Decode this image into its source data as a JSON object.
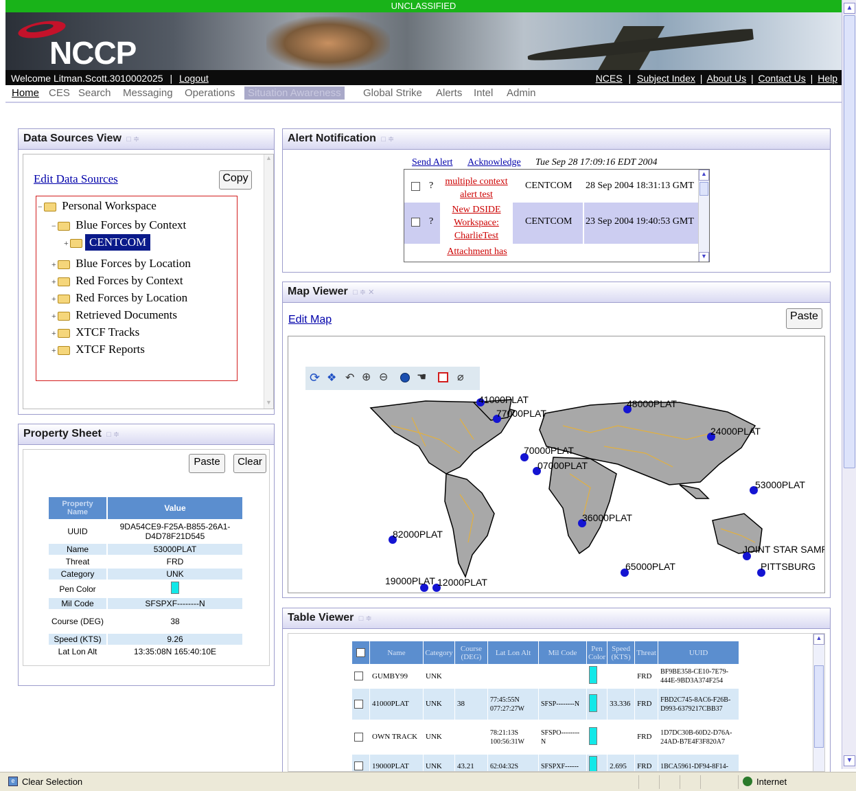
{
  "classification": "UNCLASSIFIED",
  "header": {
    "logo": "NCCP",
    "welcome": "Welcome Litman.Scott.3010002025",
    "logout": "Logout",
    "separator": "|",
    "links": [
      "NCES",
      "Subject Index",
      "About Us",
      "Contact Us",
      "Help"
    ]
  },
  "nav": {
    "tabs": [
      "Home",
      "CES",
      "Search",
      "Messaging",
      "Operations",
      "Situation Awareness",
      "Global Strike",
      "Alerts",
      "Intel",
      "Admin"
    ],
    "active": "Home",
    "selected": "Situation Awareness"
  },
  "data_sources": {
    "title": "Data Sources View",
    "edit_link": "Edit Data Sources",
    "copy_button": "Copy",
    "tree": [
      {
        "label": "Personal Workspace",
        "sign": "−"
      },
      {
        "label": "Blue Forces by Context",
        "sign": "−"
      },
      {
        "label": "CENTCOM",
        "sign": "+",
        "selected": true
      },
      {
        "label": "Blue Forces by Location",
        "sign": "+"
      },
      {
        "label": "Red Forces by Context",
        "sign": "+"
      },
      {
        "label": "Red Forces by Location",
        "sign": "+"
      },
      {
        "label": "Retrieved Documents",
        "sign": "+"
      },
      {
        "label": "XTCF Tracks",
        "sign": "+"
      },
      {
        "label": "XTCF Reports",
        "sign": "+"
      }
    ]
  },
  "property_sheet": {
    "title": "Property Sheet",
    "paste_button": "Paste",
    "clear_button": "Clear",
    "headers": [
      "Property Name",
      "Value"
    ],
    "rows": [
      {
        "name": "UUID",
        "value": "9DA54CE9-F25A-B855-26A1-D4D78F21D545"
      },
      {
        "name": "Name",
        "value": "53000PLAT"
      },
      {
        "name": "Threat",
        "value": "FRD"
      },
      {
        "name": "Category",
        "value": "UNK"
      },
      {
        "name": "Pen Color",
        "value": "",
        "color": "#13e8e8"
      },
      {
        "name": "Mil Code",
        "value": "SFSPXF--------N"
      },
      {
        "name": "Course (DEG)",
        "value": "38"
      },
      {
        "name": "Speed (KTS)",
        "value": "9.26"
      },
      {
        "name": "Lat Lon Alt",
        "value": "13:35:08N 165:40:10E"
      }
    ]
  },
  "alerts": {
    "title": "Alert Notification",
    "send_alert": "Send Alert",
    "acknowledge": "Acknowledge",
    "timestamp": "Tue Sep 28 17:09:16 EDT 2004",
    "rows": [
      {
        "status": "?",
        "title": "multiple context alert test",
        "org": "CENTCOM",
        "time": "28 Sep 2004 18:31:13 GMT"
      },
      {
        "status": "?",
        "title": "New DSIDE Workspace: CharlieTest",
        "org": "CENTCOM",
        "time": "23 Sep 2004 19:40:53 GMT"
      },
      {
        "status": "?",
        "title": "Attachment has",
        "org": "",
        "time": ""
      }
    ]
  },
  "map_viewer": {
    "title": "Map Viewer",
    "edit_link": "Edit Map",
    "paste_button": "Paste",
    "tools": [
      "refresh-icon",
      "layers-icon",
      "undo-icon",
      "zoom-in-icon",
      "zoom-out-icon",
      "globe-icon",
      "pan-hand-icon",
      "select-box-icon",
      "eraser-icon"
    ],
    "tracks": [
      "41000PLAT",
      "77000PLAT",
      "48000PLAT",
      "24000PLAT",
      "70000PLAT",
      "07000PLAT",
      "53000PLAT",
      "36000PLAT",
      "82000PLAT",
      "JOINT STAR SAMPI",
      "PITTSBURG",
      "65000PLAT",
      "19000PLAT",
      "12000PLAT"
    ]
  },
  "table_viewer": {
    "title": "Table Viewer",
    "headers": [
      "Name",
      "Category",
      "Course (DEG)",
      "Lat Lon Alt",
      "Mil Code",
      "Pen Color",
      "Speed (KTS)",
      "Threat",
      "UUID"
    ],
    "rows": [
      {
        "name": "GUMBY99",
        "category": "UNK",
        "course": "",
        "latlon": "",
        "milcode": "",
        "speed": "",
        "threat": "FRD",
        "uuid": "BF9BE358-CE10-7E79-444E-9BD3A374F254"
      },
      {
        "name": "41000PLAT",
        "category": "UNK",
        "course": "38",
        "latlon": "77:45:55N 077:27:27W",
        "milcode": "SFSP--------N",
        "speed": "33.336",
        "threat": "FRD",
        "uuid": "FBD2C745-8AC6-F26B-D993-6379217CBB37"
      },
      {
        "name": "OWN TRACK",
        "category": "UNK",
        "course": "",
        "latlon": "78:21:13S 100:56:31W",
        "milcode": "SFSPO--------N",
        "speed": "",
        "threat": "FRD",
        "uuid": "1D7DC30B-60D2-D76A-24AD-B7E4F3F820A7"
      },
      {
        "name": "19000PLAT",
        "category": "UNK",
        "course": "43.21",
        "latlon": "62:04:32S",
        "milcode": "SFSPXF------",
        "speed": "2.695",
        "threat": "FRD",
        "uuid": "1BCA5961-DF94-8F14-"
      }
    ]
  },
  "statusbar": {
    "left": "Clear Selection",
    "zone": "Internet"
  }
}
